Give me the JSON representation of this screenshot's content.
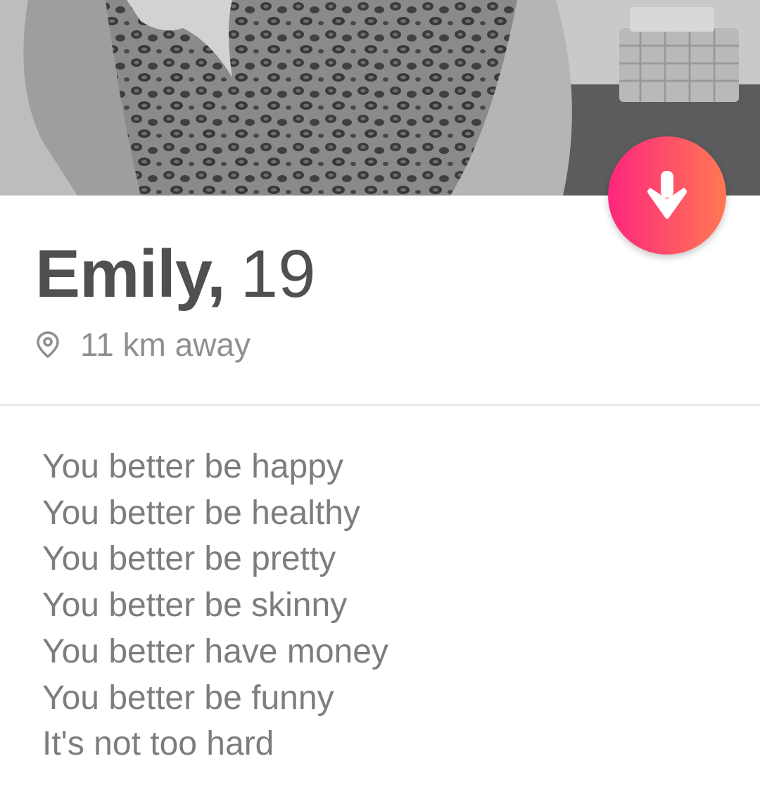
{
  "profile": {
    "name": "Emily,",
    "age": "19",
    "distance": "11 km away"
  },
  "icons": {
    "action_button": "arrow-down-icon",
    "distance": "location-pin-icon"
  },
  "colors": {
    "accent_start": "#fd267d",
    "accent_end": "#ff7854",
    "name_text": "#505050",
    "secondary_text": "#8f8f8f"
  },
  "bio": {
    "lines": [
      "You better be happy",
      "You better be healthy",
      "You better be pretty",
      "You better be skinny",
      "You better have money",
      "You better be funny",
      "It's not too hard"
    ]
  }
}
